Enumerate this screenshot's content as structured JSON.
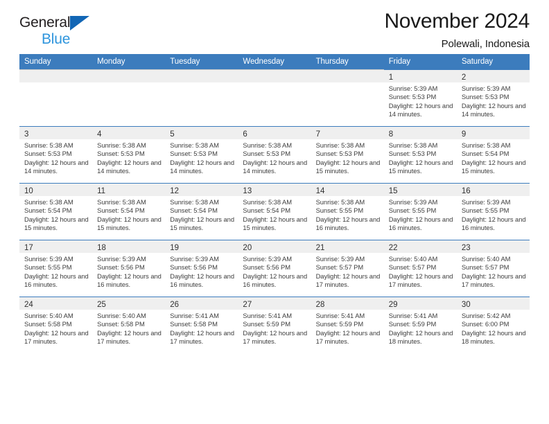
{
  "brand": {
    "line1": "General",
    "line2": "Blue",
    "triangle_color": "#1266b5",
    "line2_color": "#2e95dd"
  },
  "header": {
    "title": "November 2024",
    "subtitle": "Polewali, Indonesia"
  },
  "theme": {
    "header_bg": "#3c7cbd",
    "daynum_bg": "#efefef",
    "cell_border": "#3c7cbd",
    "blank_border": "#c8c8c8",
    "text": "#3d3d3d"
  },
  "calendar": {
    "weekday_headers": [
      "Sunday",
      "Monday",
      "Tuesday",
      "Wednesday",
      "Thursday",
      "Friday",
      "Saturday"
    ],
    "weeks": [
      [
        {
          "blank": true
        },
        {
          "blank": true
        },
        {
          "blank": true
        },
        {
          "blank": true
        },
        {
          "blank": true
        },
        {
          "day": "1",
          "sunrise": "Sunrise: 5:39 AM",
          "sunset": "Sunset: 5:53 PM",
          "daylight": "Daylight: 12 hours and 14 minutes."
        },
        {
          "day": "2",
          "sunrise": "Sunrise: 5:39 AM",
          "sunset": "Sunset: 5:53 PM",
          "daylight": "Daylight: 12 hours and 14 minutes."
        }
      ],
      [
        {
          "day": "3",
          "sunrise": "Sunrise: 5:38 AM",
          "sunset": "Sunset: 5:53 PM",
          "daylight": "Daylight: 12 hours and 14 minutes."
        },
        {
          "day": "4",
          "sunrise": "Sunrise: 5:38 AM",
          "sunset": "Sunset: 5:53 PM",
          "daylight": "Daylight: 12 hours and 14 minutes."
        },
        {
          "day": "5",
          "sunrise": "Sunrise: 5:38 AM",
          "sunset": "Sunset: 5:53 PM",
          "daylight": "Daylight: 12 hours and 14 minutes."
        },
        {
          "day": "6",
          "sunrise": "Sunrise: 5:38 AM",
          "sunset": "Sunset: 5:53 PM",
          "daylight": "Daylight: 12 hours and 14 minutes."
        },
        {
          "day": "7",
          "sunrise": "Sunrise: 5:38 AM",
          "sunset": "Sunset: 5:53 PM",
          "daylight": "Daylight: 12 hours and 15 minutes."
        },
        {
          "day": "8",
          "sunrise": "Sunrise: 5:38 AM",
          "sunset": "Sunset: 5:53 PM",
          "daylight": "Daylight: 12 hours and 15 minutes."
        },
        {
          "day": "9",
          "sunrise": "Sunrise: 5:38 AM",
          "sunset": "Sunset: 5:54 PM",
          "daylight": "Daylight: 12 hours and 15 minutes."
        }
      ],
      [
        {
          "day": "10",
          "sunrise": "Sunrise: 5:38 AM",
          "sunset": "Sunset: 5:54 PM",
          "daylight": "Daylight: 12 hours and 15 minutes."
        },
        {
          "day": "11",
          "sunrise": "Sunrise: 5:38 AM",
          "sunset": "Sunset: 5:54 PM",
          "daylight": "Daylight: 12 hours and 15 minutes."
        },
        {
          "day": "12",
          "sunrise": "Sunrise: 5:38 AM",
          "sunset": "Sunset: 5:54 PM",
          "daylight": "Daylight: 12 hours and 15 minutes."
        },
        {
          "day": "13",
          "sunrise": "Sunrise: 5:38 AM",
          "sunset": "Sunset: 5:54 PM",
          "daylight": "Daylight: 12 hours and 15 minutes."
        },
        {
          "day": "14",
          "sunrise": "Sunrise: 5:38 AM",
          "sunset": "Sunset: 5:55 PM",
          "daylight": "Daylight: 12 hours and 16 minutes."
        },
        {
          "day": "15",
          "sunrise": "Sunrise: 5:39 AM",
          "sunset": "Sunset: 5:55 PM",
          "daylight": "Daylight: 12 hours and 16 minutes."
        },
        {
          "day": "16",
          "sunrise": "Sunrise: 5:39 AM",
          "sunset": "Sunset: 5:55 PM",
          "daylight": "Daylight: 12 hours and 16 minutes."
        }
      ],
      [
        {
          "day": "17",
          "sunrise": "Sunrise: 5:39 AM",
          "sunset": "Sunset: 5:55 PM",
          "daylight": "Daylight: 12 hours and 16 minutes."
        },
        {
          "day": "18",
          "sunrise": "Sunrise: 5:39 AM",
          "sunset": "Sunset: 5:56 PM",
          "daylight": "Daylight: 12 hours and 16 minutes."
        },
        {
          "day": "19",
          "sunrise": "Sunrise: 5:39 AM",
          "sunset": "Sunset: 5:56 PM",
          "daylight": "Daylight: 12 hours and 16 minutes."
        },
        {
          "day": "20",
          "sunrise": "Sunrise: 5:39 AM",
          "sunset": "Sunset: 5:56 PM",
          "daylight": "Daylight: 12 hours and 16 minutes."
        },
        {
          "day": "21",
          "sunrise": "Sunrise: 5:39 AM",
          "sunset": "Sunset: 5:57 PM",
          "daylight": "Daylight: 12 hours and 17 minutes."
        },
        {
          "day": "22",
          "sunrise": "Sunrise: 5:40 AM",
          "sunset": "Sunset: 5:57 PM",
          "daylight": "Daylight: 12 hours and 17 minutes."
        },
        {
          "day": "23",
          "sunrise": "Sunrise: 5:40 AM",
          "sunset": "Sunset: 5:57 PM",
          "daylight": "Daylight: 12 hours and 17 minutes."
        }
      ],
      [
        {
          "day": "24",
          "sunrise": "Sunrise: 5:40 AM",
          "sunset": "Sunset: 5:58 PM",
          "daylight": "Daylight: 12 hours and 17 minutes."
        },
        {
          "day": "25",
          "sunrise": "Sunrise: 5:40 AM",
          "sunset": "Sunset: 5:58 PM",
          "daylight": "Daylight: 12 hours and 17 minutes."
        },
        {
          "day": "26",
          "sunrise": "Sunrise: 5:41 AM",
          "sunset": "Sunset: 5:58 PM",
          "daylight": "Daylight: 12 hours and 17 minutes."
        },
        {
          "day": "27",
          "sunrise": "Sunrise: 5:41 AM",
          "sunset": "Sunset: 5:59 PM",
          "daylight": "Daylight: 12 hours and 17 minutes."
        },
        {
          "day": "28",
          "sunrise": "Sunrise: 5:41 AM",
          "sunset": "Sunset: 5:59 PM",
          "daylight": "Daylight: 12 hours and 17 minutes."
        },
        {
          "day": "29",
          "sunrise": "Sunrise: 5:41 AM",
          "sunset": "Sunset: 5:59 PM",
          "daylight": "Daylight: 12 hours and 18 minutes."
        },
        {
          "day": "30",
          "sunrise": "Sunrise: 5:42 AM",
          "sunset": "Sunset: 6:00 PM",
          "daylight": "Daylight: 12 hours and 18 minutes."
        }
      ]
    ]
  }
}
